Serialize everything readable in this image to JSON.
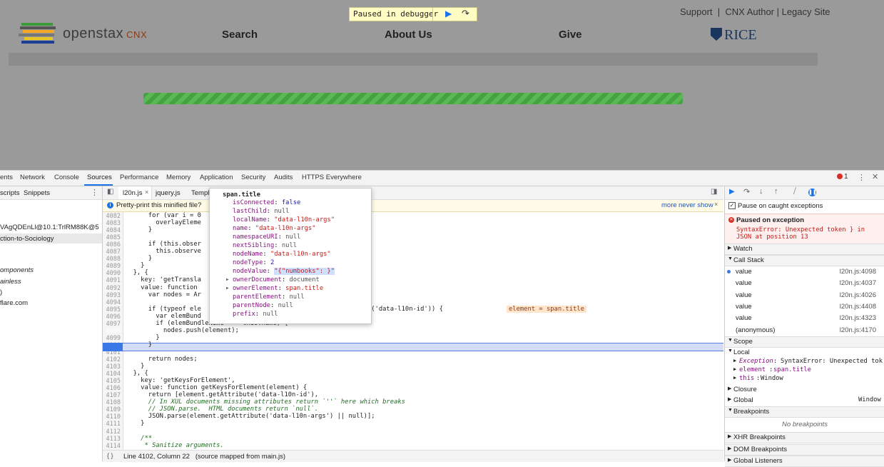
{
  "site": {
    "paused_text": "Paused in debugger",
    "logo_text": "openstax",
    "logo_cnx": "CNX",
    "nav": [
      "Search",
      "About Us",
      "Give"
    ],
    "top_links": "Support  |  CNX Author | Legacy Site",
    "rice": "RICE",
    "colors": {
      "progress": "#44a33f",
      "paused_bg": "#fffdc4"
    }
  },
  "devtools": {
    "tabs": [
      "ents",
      "Network",
      "Console",
      "Sources",
      "Performance",
      "Memory",
      "Application",
      "Security",
      "Audits",
      "HTTPS Everywhere"
    ],
    "active_tab": "Sources",
    "error_count": "1",
    "nav_tabs": [
      "scripts",
      "Snippets"
    ],
    "nav_items": [
      "VAgQDEnLl@10.1:TrlRM88K@5",
      "ction-to-Sociology",
      "omponents",
      "ainless",
      ")",
      "flare.com"
    ],
    "file_tabs": [
      "l20n.js",
      "jquery.js",
      "Templ"
    ],
    "pretty_print": {
      "message": "Pretty-print this minified file?",
      "more": "more",
      "never_show": "never show"
    },
    "status": "Line 4102, Column 22   (source mapped from main.js)"
  },
  "code_lines": [
    {
      "n": "4082",
      "t": "      for (var i = 0"
    },
    {
      "n": "4083",
      "t": "        overlayEleme"
    },
    {
      "n": "4084",
      "t": "      }"
    },
    {
      "n": "4085",
      "t": ""
    },
    {
      "n": "4086",
      "t": "      if (this.obser"
    },
    {
      "n": "4087",
      "t": "        this.observe"
    },
    {
      "n": "4088",
      "t": "      }"
    },
    {
      "n": "4089",
      "t": "    }"
    },
    {
      "n": "4090",
      "t": "  }, {"
    },
    {
      "n": "4091",
      "t": "    key: 'getTransla"
    },
    {
      "n": "4092",
      "t": "    value: function "
    },
    {
      "n": "4093",
      "t": "      var nodes = Ar                              ery));"
    },
    {
      "n": "4094",
      "t": ""
    },
    {
      "n": "4095",
      "t": "      if (typeof ele                              nt.hasAttribute('data-l10n-id')) {"
    },
    {
      "n": "4096",
      "t": "        var elemBund                              with');"
    },
    {
      "n": "4097",
      "t": "        if (elemBundleName === this.name) {"
    },
    {
      "n": "4098",
      "t": "          nodes.push(element);"
    },
    {
      "n": "4099",
      "t": "        }"
    },
    {
      "n": "4100",
      "t": "      }"
    },
    {
      "n": "4101",
      "t": ""
    },
    {
      "n": "4102",
      "t": "      return nodes;"
    },
    {
      "n": "4103",
      "t": "    }"
    },
    {
      "n": "4104",
      "t": "  }, {"
    },
    {
      "n": "4105",
      "t": "    key: 'getKeysForElement',"
    },
    {
      "n": "4106",
      "t": "    value: function getKeysForElement(element) {"
    },
    {
      "n": "4107",
      "t": "      return [element.getAttribute('data-l10n-id'),"
    },
    {
      "n": "4108",
      "t": "      // In XUL documents missing attributes return `''` here which breaks"
    },
    {
      "n": "4109",
      "t": "      // JSON.parse.  HTML documents return `null`."
    },
    {
      "n": "4110",
      "t": "      JSON.parse(element.getAttribute('data-l10n-args') || null)];"
    },
    {
      "n": "4111",
      "t": "    }"
    },
    {
      "n": "4112",
      "t": ""
    },
    {
      "n": "4113",
      "t": "    /**"
    },
    {
      "n": "4114",
      "t": "     * Sanitize arguments."
    }
  ],
  "inline_value": "element = span.title",
  "popover": {
    "title": "span.title",
    "props": [
      {
        "k": "isConnected",
        "v": "false",
        "type": "n"
      },
      {
        "k": "lastChild",
        "v": "null",
        "type": "o"
      },
      {
        "k": "localName",
        "v": "\"data-l10n-args\"",
        "type": "s"
      },
      {
        "k": "name",
        "v": "\"data-l10n-args\"",
        "type": "s"
      },
      {
        "k": "namespaceURI",
        "v": "null",
        "type": "o"
      },
      {
        "k": "nextSibling",
        "v": "null",
        "type": "o"
      },
      {
        "k": "nodeName",
        "v": "\"data-l10n-args\"",
        "type": "s"
      },
      {
        "k": "nodeType",
        "v": "2",
        "type": "n"
      },
      {
        "k": "nodeValue",
        "v": "\"{\"numbooks\": }\"",
        "type": "s"
      },
      {
        "k": "ownerDocument",
        "v": "document",
        "type": "o"
      },
      {
        "k": "ownerElement",
        "v": "span.title",
        "type": "s"
      },
      {
        "k": "parentElement",
        "v": "null",
        "type": "o"
      },
      {
        "k": "parentNode",
        "v": "null",
        "type": "o"
      },
      {
        "k": "prefix",
        "v": "null",
        "type": "o"
      }
    ]
  },
  "sidebar": {
    "pause_caught": "Pause on caught exceptions",
    "paused_on_exception": "Paused on exception",
    "exception_msg_1": "SyntaxError: Unexpected token } in",
    "exception_msg_2": "JSON at position 13",
    "watch": "Watch",
    "call_stack": "Call Stack",
    "frames": [
      {
        "fn": "value",
        "loc": "l20n.js:4098"
      },
      {
        "fn": "value",
        "loc": "l20n.js:4037"
      },
      {
        "fn": "value",
        "loc": "l20n.js:4026"
      },
      {
        "fn": "value",
        "loc": "l20n.js:4408"
      },
      {
        "fn": "value",
        "loc": "l20n.js:4323"
      },
      {
        "fn": "(anonymous)",
        "loc": "l20n.js:4170"
      }
    ],
    "scope": "Scope",
    "local": "Local",
    "scope_items": [
      {
        "k": "Exception",
        "v": "SyntaxError: Unexpected tok"
      },
      {
        "k": "element",
        "v": "span.title"
      },
      {
        "k": "this",
        "v": "Window"
      }
    ],
    "closure": "Closure",
    "global": "Global",
    "global_val": "Window",
    "breakpoints": "Breakpoints",
    "no_breakpoints": "No breakpoints",
    "xhr": "XHR Breakpoints",
    "dom": "DOM Breakpoints",
    "listeners": "Global Listeners"
  }
}
